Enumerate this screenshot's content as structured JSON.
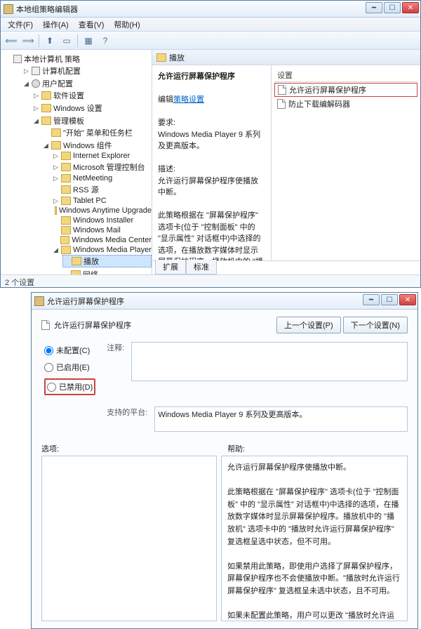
{
  "window": {
    "title": "本地组策略编辑器",
    "menus": [
      "文件(F)",
      "操作(A)",
      "查看(V)",
      "帮助(H)"
    ],
    "toolbar_icons": [
      "⟸",
      "⟹",
      "⬆",
      "📄",
      "🔄",
      "❓"
    ]
  },
  "tree": {
    "root": "本地计算机 策略",
    "computer": "计算机配置",
    "user": "用户配置",
    "soft": "软件设置",
    "winset": "Windows 设置",
    "admtpl": "管理模板",
    "startmenu": "\"开始\" 菜单和任务栏",
    "wincomp": "Windows 组件",
    "ie": "Internet Explorer",
    "mmc": "Microsoft 管理控制台",
    "nm": "NetMeeting",
    "rss": "RSS 源",
    "tablet": "Tablet PC",
    "wau": "Windows Anytime Upgrade",
    "wi": "Windows Installer",
    "wmail": "Windows Mail",
    "wmc": "Windows Media Center",
    "wmp": "Windows Media Player",
    "play": "播放",
    "net": "网络"
  },
  "rightpane": {
    "header": "播放",
    "title": "允许运行屏幕保护程序",
    "edit_link_prefix": "编辑",
    "edit_link": "策略设置",
    "req_label": "要求:",
    "req_text": "Windows Media Player 9 系列及更高版本。",
    "desc_label": "描述:",
    "desc_text": "允许运行屏幕保护程序使播放中断。",
    "desc_text2": "此策略根据在 \"屏幕保护程序\" 选项卡(位于 \"控制面板\" 中的 \"显示属性\" 对话框中)中选择的选项，在播放数字媒体时显示屏幕保护程序。播放机中的 \"播放机\" 选项卡中的 \"播放时允许运行屏幕保护程序\" 复选框呈选中状态，但不可用。",
    "list_header": "设置",
    "item1": "允许运行屏幕保护程序",
    "item2": "防止下载编解码器",
    "tab1": "扩展",
    "tab2": "标准"
  },
  "status": "2 个设置",
  "dialog": {
    "title": "允许运行屏幕保护程序",
    "heading": "允许运行屏幕保护程序",
    "prev": "上一个设置(P)",
    "next": "下一个设置(N)",
    "r_notconf": "未配置(C)",
    "r_enabled": "已启用(E)",
    "r_disabled": "已禁用(D)",
    "lbl_comment": "注释:",
    "lbl_platform": "支持的平台:",
    "platform_text": "Windows Media Player 9 系列及更高版本。",
    "lbl_options": "选项:",
    "lbl_help": "帮助:",
    "help_p1": "允许运行屏幕保护程序使播放中断。",
    "help_p2": "此策略根据在 \"屏幕保护程序\" 选项卡(位于 \"控制面板\" 中的 \"显示属性\" 对话框中)中选择的选项，在播放数字媒体时显示屏幕保护程序。播放机中的 \"播放机\" 选项卡中的 \"播放时允许运行屏幕保护程序\" 复选框呈选中状态，但不可用。",
    "help_p3": "如果禁用此策略，即使用户选择了屏幕保护程序，屏幕保护程序也不会使播放中断。\"播放时允许运行屏幕保护程序\" 复选框呈未选中状态，且不可用。",
    "help_p4": "如果未配置此策略，用户可以更改 \"播放时允许运行屏幕保护程序\" 复选框的设置。"
  }
}
